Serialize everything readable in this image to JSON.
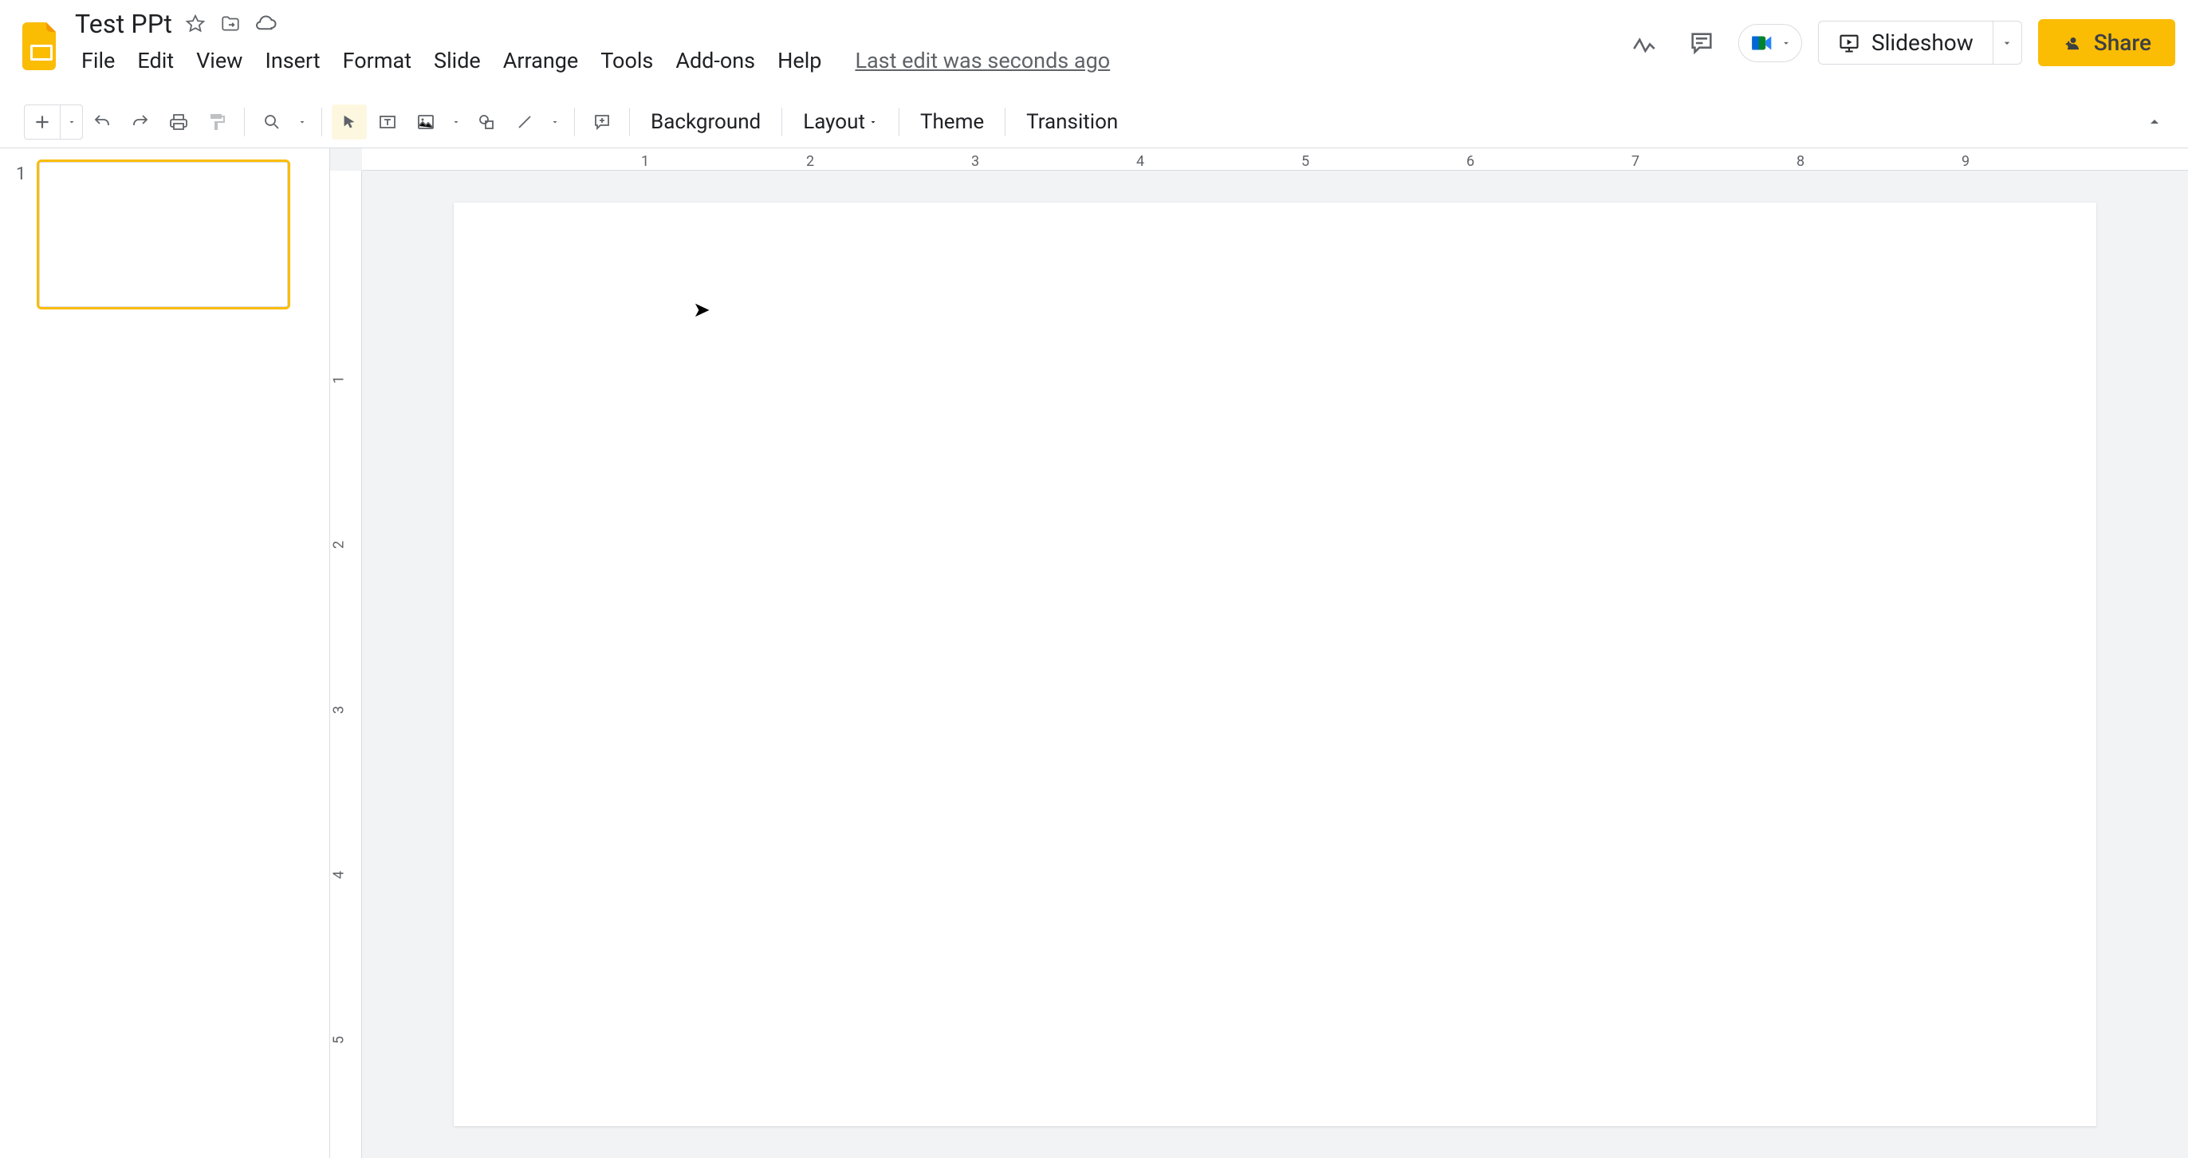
{
  "doc": {
    "title": "Test PPt"
  },
  "menu": {
    "file": "File",
    "edit": "Edit",
    "view": "View",
    "insert": "Insert",
    "format": "Format",
    "slide": "Slide",
    "arrange": "Arrange",
    "tools": "Tools",
    "addons": "Add-ons",
    "help": "Help",
    "last_edit": "Last edit was seconds ago"
  },
  "header_actions": {
    "slideshow": "Slideshow",
    "share": "Share"
  },
  "toolbar": {
    "background": "Background",
    "layout": "Layout",
    "theme": "Theme",
    "transition": "Transition"
  },
  "filmstrip": {
    "slides": [
      {
        "num": "1"
      }
    ]
  },
  "ruler": {
    "h": [
      "1",
      "2",
      "3",
      "4",
      "5",
      "6",
      "7",
      "8",
      "9"
    ],
    "v": [
      "1",
      "2",
      "3",
      "4",
      "5"
    ]
  }
}
